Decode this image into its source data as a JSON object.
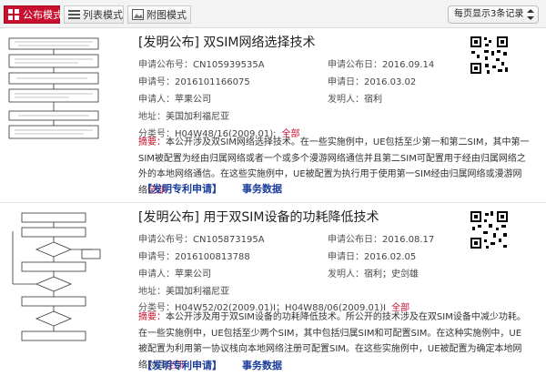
{
  "toolbar": {
    "tabs": [
      {
        "label": "公布模式",
        "icon": "grid-icon",
        "active": true
      },
      {
        "label": "列表模式",
        "icon": "list-icon",
        "active": false
      },
      {
        "label": "附图模式",
        "icon": "image-icon",
        "active": false
      }
    ],
    "page_size": "每页显示3条记录"
  },
  "field_labels": {
    "pub_no": "申请公布号：",
    "pub_date": "申请公布日：",
    "app_no": "申请号：",
    "app_date": "申请日：",
    "applicant": "申请人：",
    "inventor": "发明人：",
    "address": "地址：",
    "ipc": "分类号：",
    "abstract": "摘要："
  },
  "records": [
    {
      "title": "[发明公布] 双SIM网络选择技术",
      "pub_no": "CN105939535A",
      "pub_date": "2016.09.14",
      "app_no": "2016101166075",
      "app_date": "2016.03.02",
      "applicant": "苹果公司",
      "inventor": "宿利",
      "address": "美国加利福尼亚",
      "ipc": "H04W48/16(2009.01);",
      "ipc_all": "全部",
      "abstract": "本公开涉及双SIM网络选择技术。在一些实施例中，UE包括至少第一和第二SIM，其中第一SIM被配置为经由归属网络或者一个或多个漫游网络通信并且第二SIM可配置用于经由归属网络之外的本地网络通信。在这些实施例中，UE被配置为执行用于使用第一SIM经由归属网络或漫游网络",
      "abstract_more": "全部",
      "links": [
        "【发明专利申请】",
        "事务数据"
      ]
    },
    {
      "title": "[发明公布] 用于双SIM设备的功耗降低技术",
      "pub_no": "CN105873195A",
      "pub_date": "2016.08.17",
      "app_no": "2016100813788",
      "app_date": "2016.02.05",
      "applicant": "苹果公司",
      "inventor": "宿利；史剑雄",
      "address": "美国加利福尼亚",
      "ipc": "H04W52/02(2009.01)I；H04W88/06(2009.01)I",
      "ipc_all": "全部",
      "abstract": "本公开涉及用于双SIM设备的功耗降低技术。所公开的技术涉及在双SIM设备中减少功耗。在一些实施例中，UE包括至少两个SIM，其中包括归属SIM和可配置SIM。在这种实施例中，UE被配置为利用第一协议栈向本地网络注册可配置SIM。在这些实施例中，UE被配置为确定本地网络对目",
      "abstract_more": "全部",
      "links": [
        "【发明专利申请】",
        "事务数据"
      ]
    }
  ]
}
